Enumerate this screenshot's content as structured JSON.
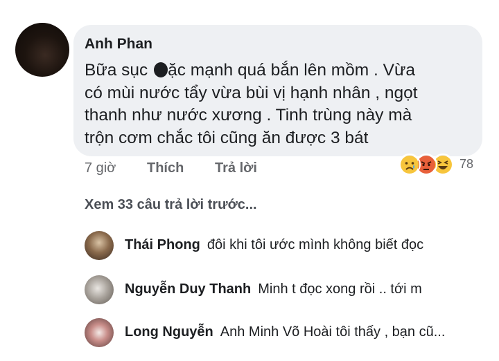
{
  "comment": {
    "author": "Anh Phan",
    "text_lines": [
      "Bữa sục ",
      "ặc mạnh quá bắn lên mồm . Vừa",
      "có mùi nước tẩy vừa bùi vị hạnh nhân , ngọt",
      "thanh như nước xương . Tinh trùng này mà",
      "trộn cơm chắc tôi cũng ăn được 3 bát"
    ],
    "time": "7 giờ",
    "like_label": "Thích",
    "reply_label": "Trả lời",
    "reactions": {
      "icons": [
        "sad-reaction-icon",
        "angry-reaction-icon",
        "haha-reaction-icon"
      ],
      "count": "78"
    }
  },
  "replies_section": {
    "view_more_label": "Xem 33 câu trả lời trước...",
    "replies": [
      {
        "name": "Thái Phong",
        "text": "đôi khi tôi ước mình không biết đọc"
      },
      {
        "name": "Nguyễn Duy Thanh",
        "text": "Minh t đọc xong rồi .. tới m"
      },
      {
        "name": "Long Nguyễn",
        "text": "Anh Minh Võ Hoài tôi thấy , bạn cũ..."
      }
    ]
  }
}
